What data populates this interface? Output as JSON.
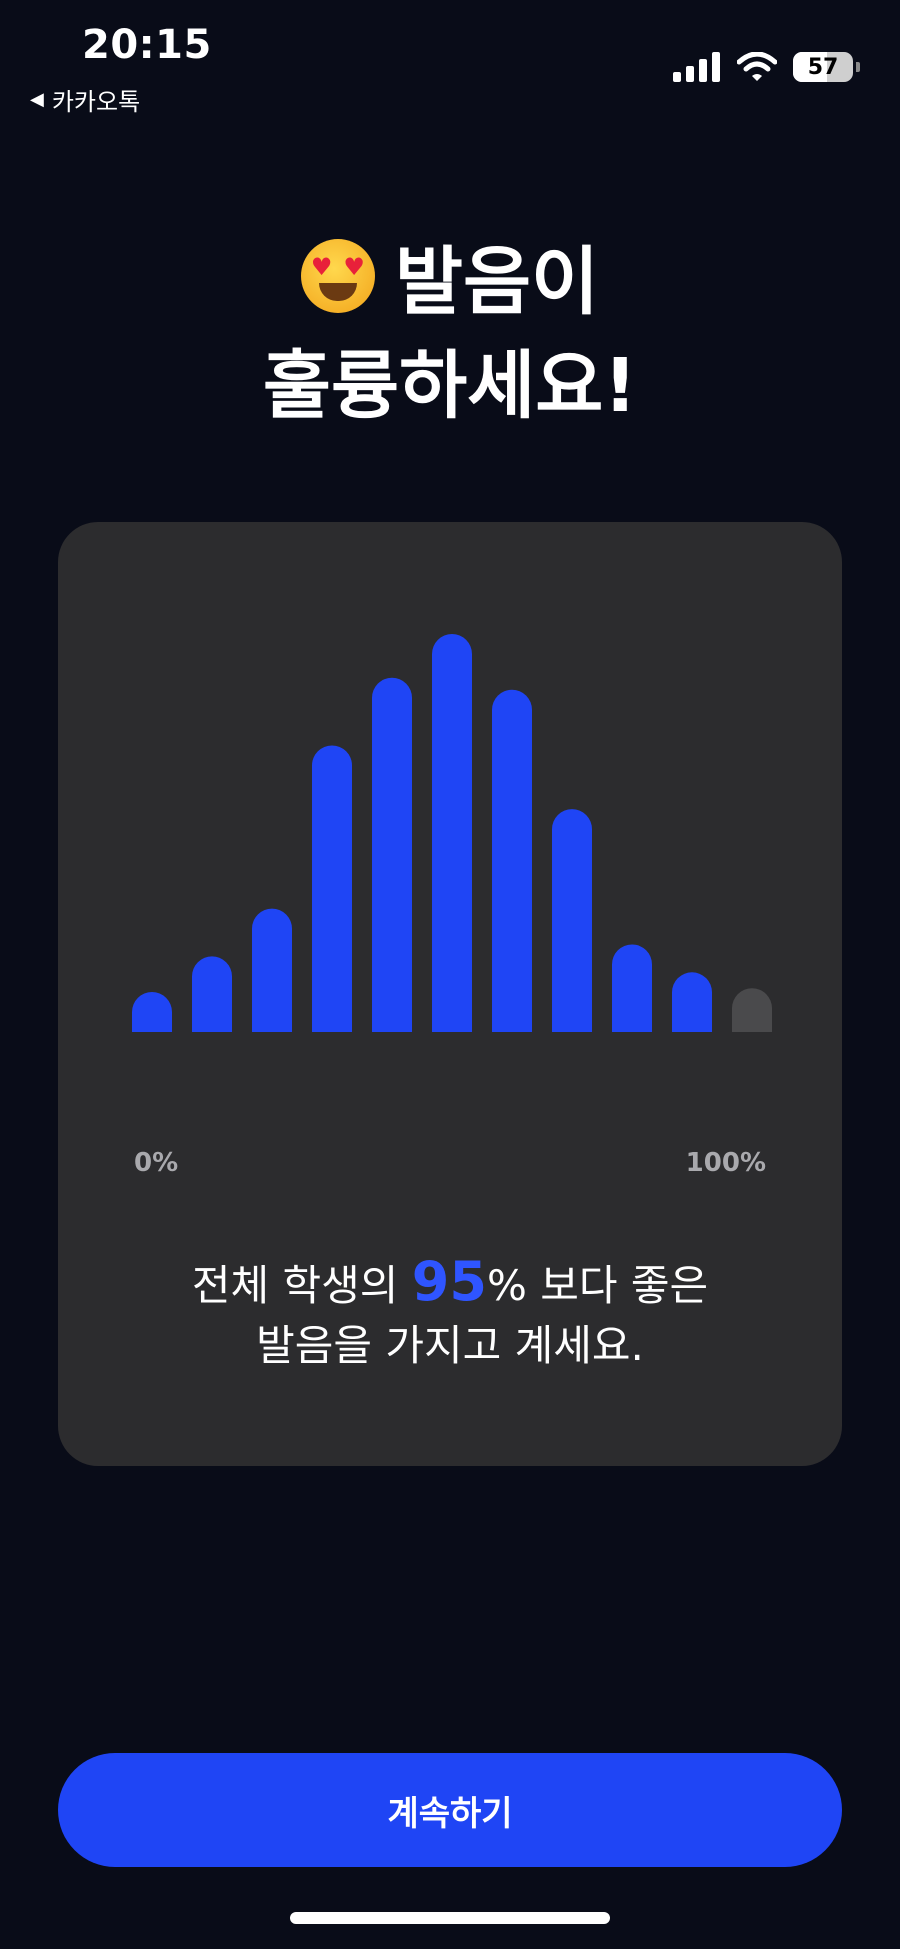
{
  "status_bar": {
    "time": "20:15",
    "back_label": "카카오톡",
    "battery": "57"
  },
  "title": {
    "emoji": "heart-eyes-emoji",
    "line1": "발음이",
    "line2": "훌륭하세요!"
  },
  "chart_data": {
    "type": "bar",
    "x_start_label": "0%",
    "x_end_label": "100%",
    "values": [
      7,
      19,
      31,
      72,
      89,
      100,
      86,
      56,
      22,
      15,
      11
    ],
    "highlight_color": "#1f45f5",
    "inactive_color": "#4a4a4c",
    "active_count": 10
  },
  "message": {
    "prefix": "전체 학생의 ",
    "percent": "95",
    "suffix": "% 보다 좋은",
    "line2": "발음을 가지고 계세요."
  },
  "cta": {
    "label": "계속하기"
  }
}
